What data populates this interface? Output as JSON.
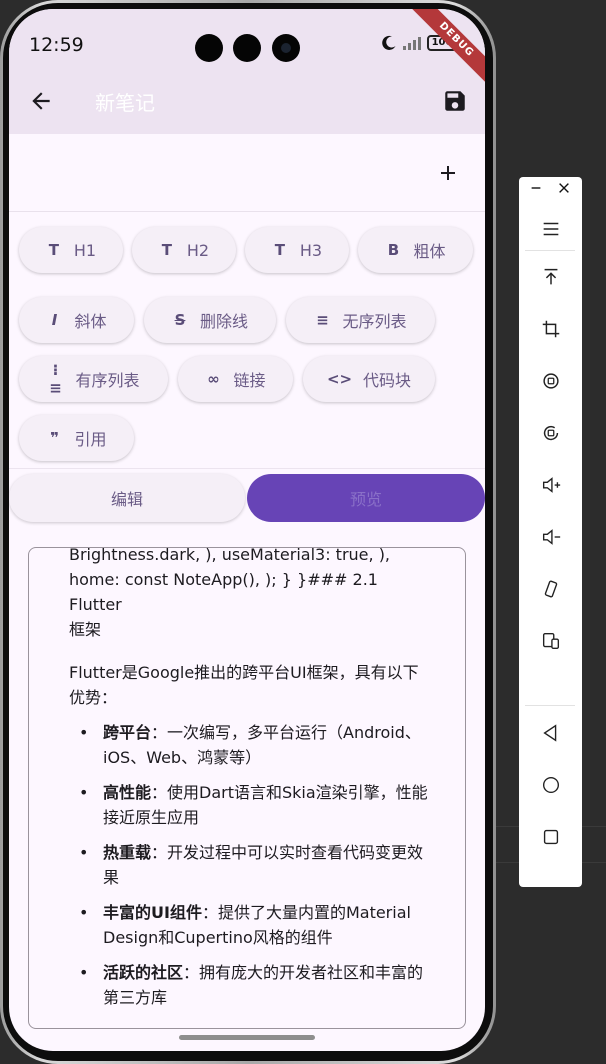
{
  "status_bar": {
    "time": "12:59",
    "battery": "100",
    "debug_label": "DEBUG"
  },
  "app_bar": {
    "title": "新笔记"
  },
  "title_input": {
    "value": "",
    "placeholder": ""
  },
  "toolbar": {
    "chips": [
      {
        "icon": "T",
        "label": "H1"
      },
      {
        "icon": "T",
        "label": "H2"
      },
      {
        "icon": "T",
        "label": "H3"
      },
      {
        "icon": "B",
        "label": "粗体"
      },
      {
        "icon": "I",
        "label": "斜体"
      },
      {
        "icon": "S",
        "label": "删除线"
      },
      {
        "icon": "≡",
        "label": "无序列表"
      },
      {
        "icon": "⁝≡",
        "label": "有序列表"
      },
      {
        "icon": "∞",
        "label": "链接"
      },
      {
        "icon": "<>",
        "label": "代码块"
      },
      {
        "icon": "❞",
        "label": "引用"
      }
    ]
  },
  "mode_toggle": {
    "edit": "编辑",
    "preview": "预览",
    "selected": "preview"
  },
  "preview": {
    "code_line1": "Brightness.dark, ), useMaterial3: true, ),",
    "code_line2": "home: const NoteApp(), ); } }### 2.1 Flutter",
    "code_line3": "框架",
    "paragraph": "Flutter是Google推出的跨平台UI框架，具有以下优势：",
    "items": [
      {
        "bold": "跨平台",
        "text": "：一次编写，多平台运行（Android、iOS、Web、鸿蒙等）"
      },
      {
        "bold": "高性能",
        "text": "：使用Dart语言和Skia渲染引擎，性能接近原生应用"
      },
      {
        "bold": "热重载",
        "text": "：开发过程中可以实时查看代码变更效果"
      },
      {
        "bold": "丰富的UI组件",
        "text": "：提供了大量内置的Material Design和Cupertino风格的组件"
      },
      {
        "bold": "活跃的社区",
        "text": "：拥有庞大的开发者社区和丰富的第三方库"
      }
    ]
  },
  "colors": {
    "app_bar_bg": "#ede3f1",
    "accent": "#6744b6",
    "chip_bg": "#f5eff7",
    "surface": "#fdf7ff"
  }
}
